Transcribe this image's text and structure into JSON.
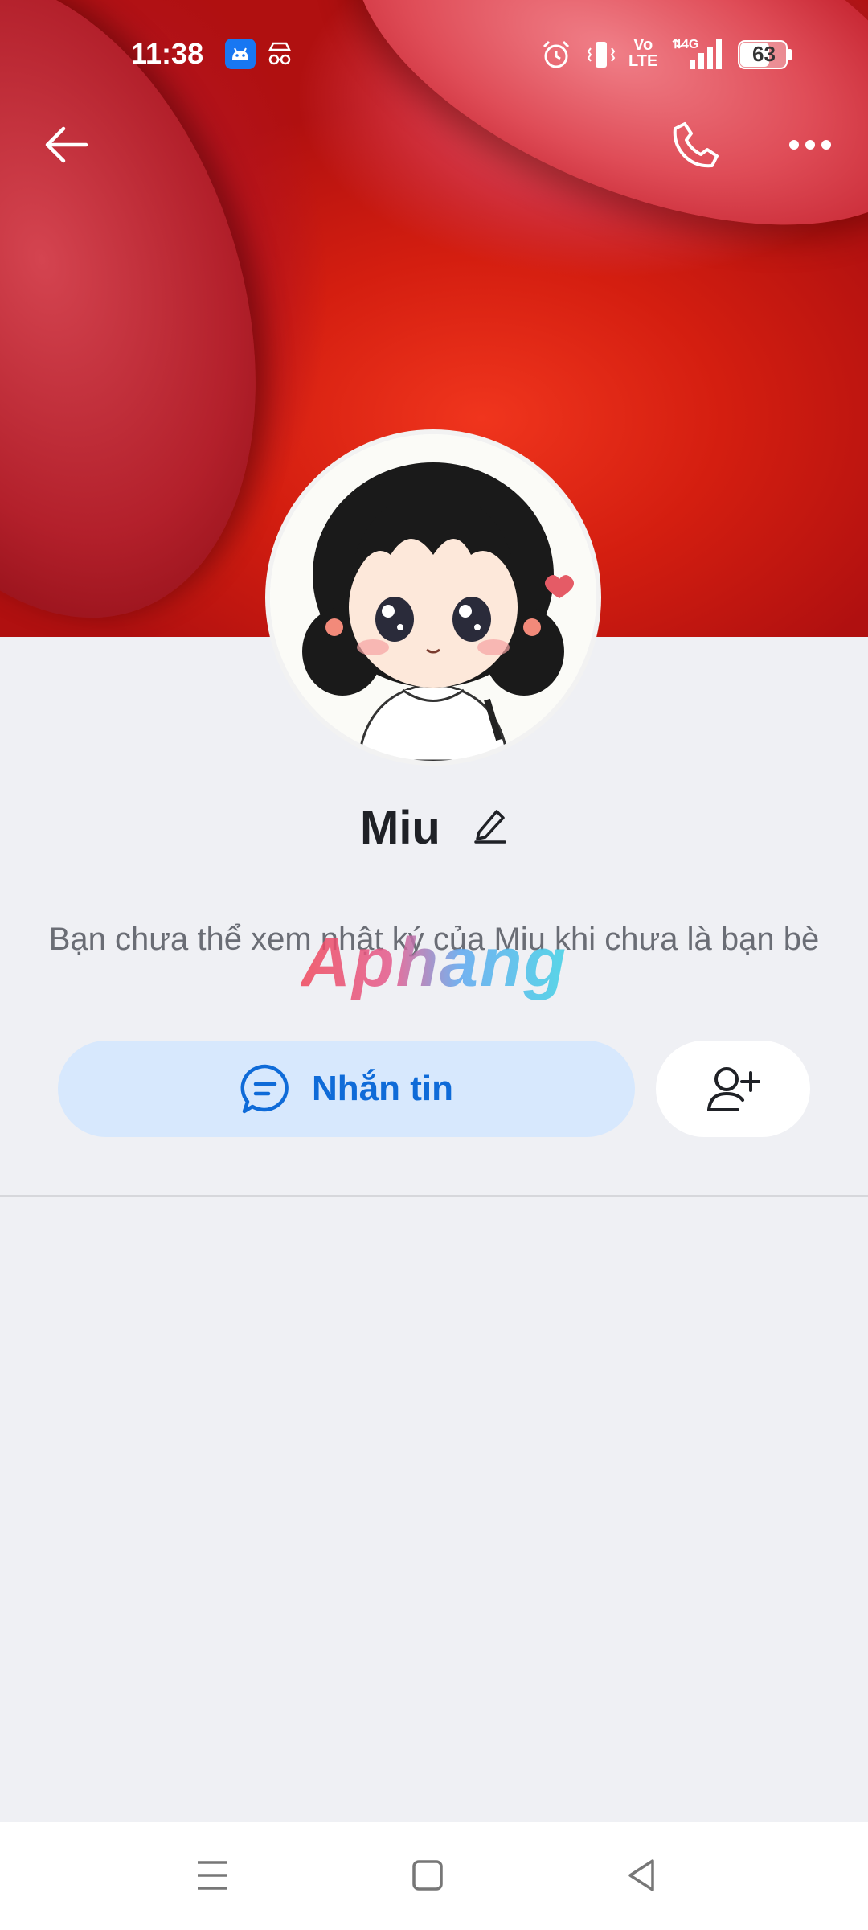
{
  "status_bar": {
    "time": "11:38",
    "battery": "63",
    "network_label_vo": "Vo",
    "network_label_lte": "LTE",
    "network_gen": "4G"
  },
  "header": {
    "back_icon": "arrow-left-icon",
    "call_icon": "phone-icon",
    "more_icon": "more-horizontal-icon"
  },
  "profile": {
    "name": "Miu",
    "notice": "Bạn chưa thể xem nhật ký của Miu khi chưa là bạn bè",
    "watermark": "Aphang"
  },
  "actions": {
    "message_label": "Nhắn tin",
    "message_icon": "chat-bubble-icon",
    "add_friend_icon": "add-user-icon"
  },
  "colors": {
    "accent": "#0f6bd8",
    "message_button_bg": "#d7e8fd",
    "page_bg": "#eff0f4"
  },
  "nav": {
    "recent_icon": "menu-icon",
    "home_icon": "square-icon",
    "back_icon": "triangle-back-icon"
  }
}
